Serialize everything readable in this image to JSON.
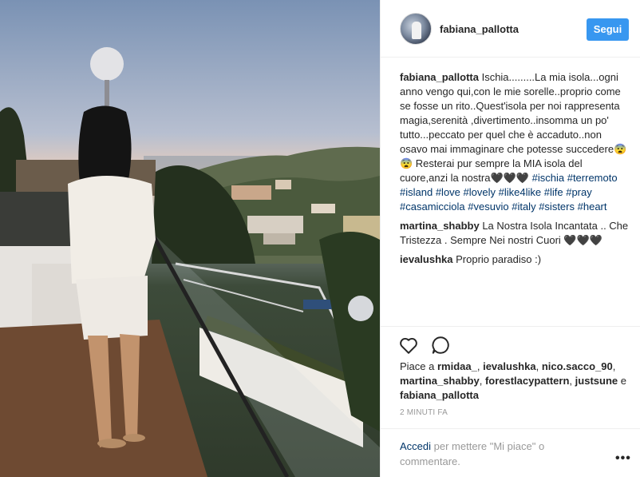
{
  "header": {
    "username": "fabiana_pallotta",
    "follow_label": "Segui"
  },
  "caption": {
    "user": "fabiana_pallotta",
    "text": " Ischia.........La mia isola...ogni anno vengo qui,con le mie sorelle..proprio come se fosse un rito..Quest'isola per noi rappresenta magia,serenità ,divertimento..insomma un po' tutto...peccato per quel che è accaduto..non osavo mai immaginare che potesse succedere😨😨 Resterai pur sempre la MIA isola del cuore,anzi la nostra🖤🖤🖤 ",
    "hashtags": [
      "#ischia",
      "#terremoto",
      "#island",
      "#love",
      "#lovely",
      "#like4like",
      "#life",
      "#pray",
      "#casamicciola",
      "#vesuvio",
      "#italy",
      "#sisters",
      "#heart"
    ]
  },
  "comments": [
    {
      "user": "martina_shabby",
      "text": " La Nostra Isola Incantata .. Che Tristezza . Sempre Nei nostri Cuori 🖤🖤🖤"
    },
    {
      "user": "ievalushka",
      "text": " Proprio paradiso :)"
    }
  ],
  "likes": {
    "prefix": "Piace a ",
    "users": [
      "rmidaa_",
      "ievalushka",
      "nico.sacco_90",
      "martina_shabby",
      "forestlacypattern",
      "justsune"
    ],
    "conjunction": " e ",
    "last": "fabiana_pallotta"
  },
  "time": "2 MINUTI FA",
  "login": {
    "link": "Accedi",
    "text": " per mettere \"Mi piace\" o commentare."
  },
  "more_label": "•••",
  "icons": [
    "heart-icon",
    "comment-icon",
    "more-options-icon"
  ],
  "colors": {
    "accent": "#3897f0",
    "link": "#003569",
    "muted": "#999999"
  }
}
